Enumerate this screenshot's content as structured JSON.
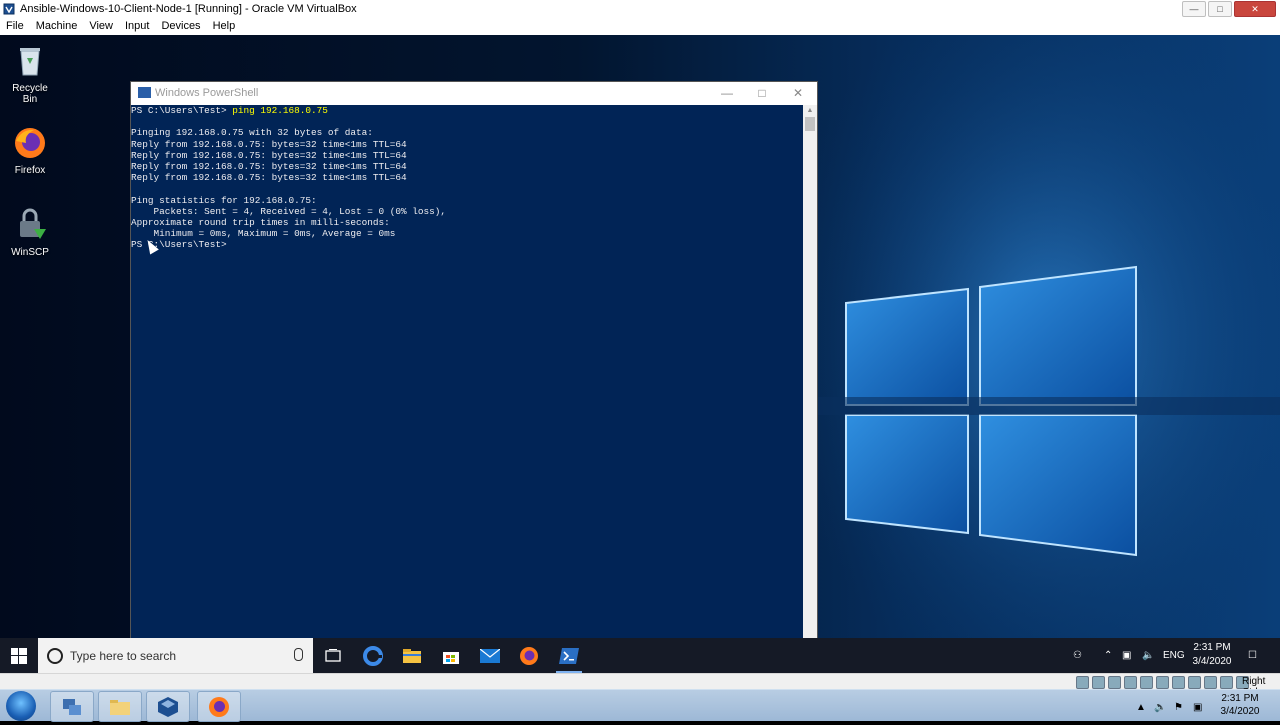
{
  "vbox": {
    "title": "Ansible-Windows-10-Client-Node-1 [Running] - Oracle VM VirtualBox",
    "menu": [
      "File",
      "Machine",
      "View",
      "Input",
      "Devices",
      "Help"
    ],
    "status_host_key": "Right Ctrl"
  },
  "desktop_icons": [
    {
      "label": "Recycle Bin",
      "icon": "recycle-bin-icon"
    },
    {
      "label": "Firefox",
      "icon": "firefox-icon"
    },
    {
      "label": "WinSCP",
      "icon": "winscp-icon"
    }
  ],
  "powershell": {
    "title": "Windows PowerShell",
    "prompt1": "PS C:\\Users\\Test> ",
    "command": "ping 192.168.0.75",
    "output": [
      "",
      "Pinging 192.168.0.75 with 32 bytes of data:",
      "Reply from 192.168.0.75: bytes=32 time<1ms TTL=64",
      "Reply from 192.168.0.75: bytes=32 time<1ms TTL=64",
      "Reply from 192.168.0.75: bytes=32 time<1ms TTL=64",
      "Reply from 192.168.0.75: bytes=32 time<1ms TTL=64",
      "",
      "Ping statistics for 192.168.0.75:",
      "    Packets: Sent = 4, Received = 4, Lost = 0 (0% loss),",
      "Approximate round trip times in milli-seconds:",
      "    Minimum = 0ms, Maximum = 0ms, Average = 0ms",
      "PS C:\\Users\\Test>"
    ],
    "bg_color": "#012456",
    "command_color": "#ffff00"
  },
  "taskbar": {
    "search_placeholder": "Type here to search",
    "apps": [
      "task-view-icon",
      "edge-icon",
      "file-explorer-icon",
      "store-icon",
      "mail-icon",
      "firefox-icon",
      "powershell-icon"
    ],
    "language": "ENG",
    "time": "2:31 PM",
    "date": "3/4/2020"
  },
  "host_taskbar": {
    "time": "2:31 PM",
    "date": "3/4/2020",
    "apps": [
      "network-app-icon",
      "folder-icon",
      "virtualbox-icon",
      "firefox-icon"
    ]
  }
}
